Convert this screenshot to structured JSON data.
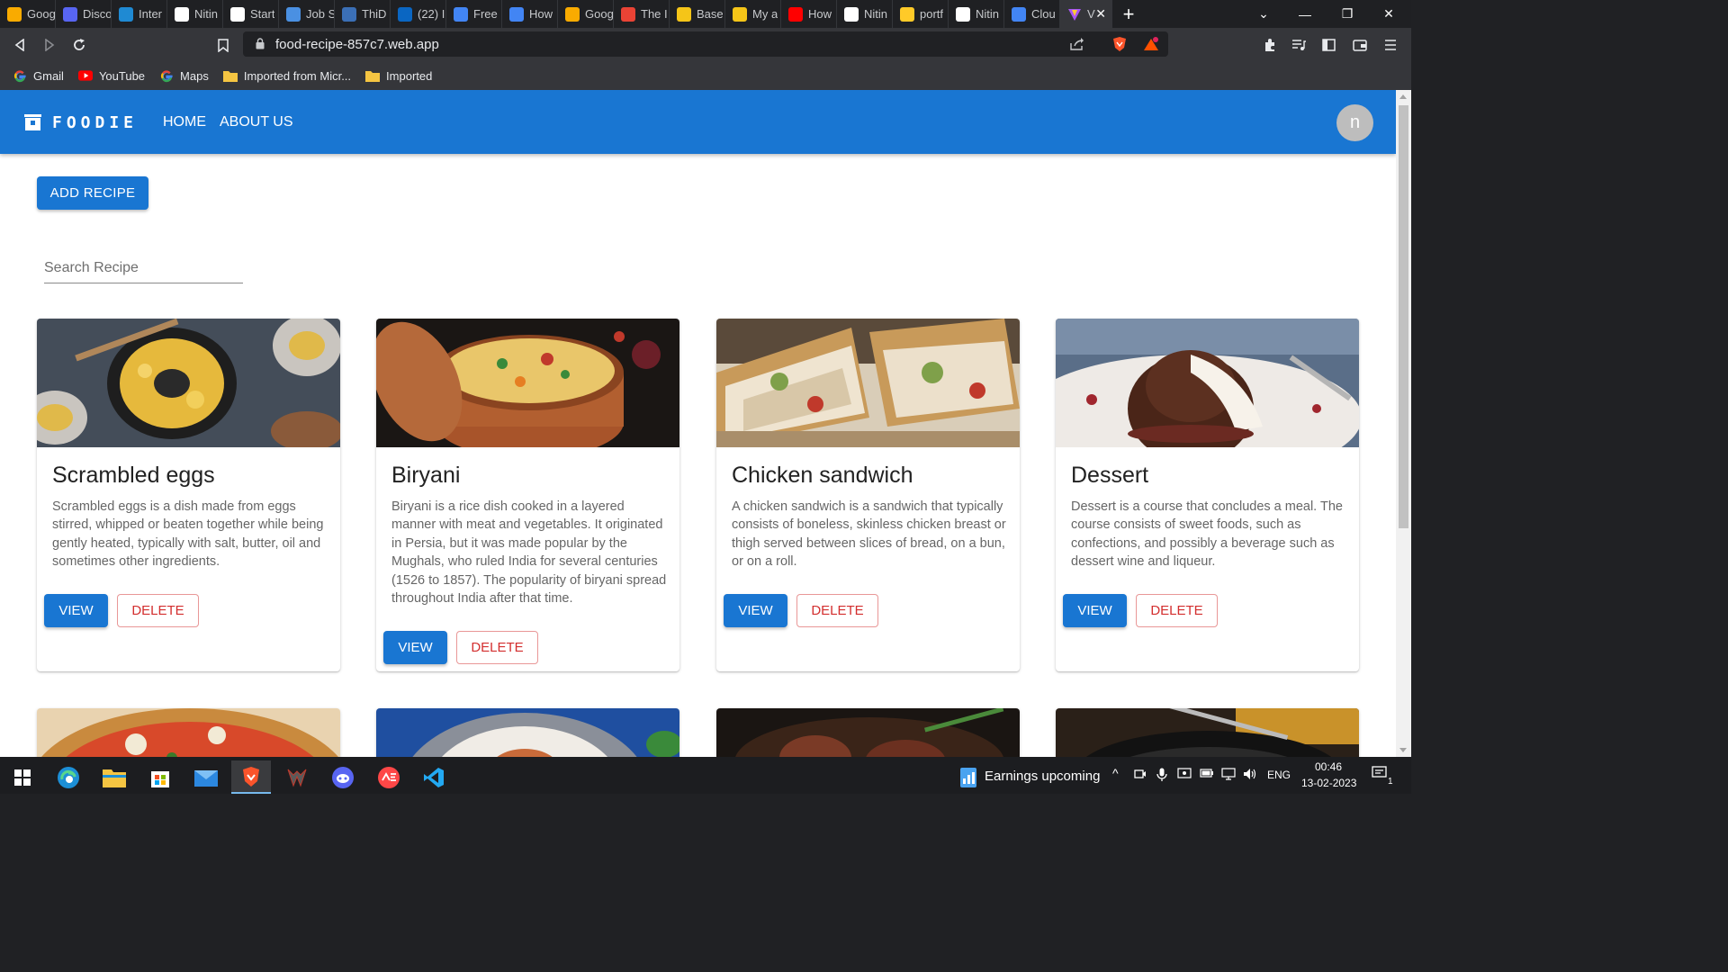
{
  "browser": {
    "tabs": [
      {
        "title": "Goog",
        "icon": "keep-icon",
        "color": "#f9ab00"
      },
      {
        "title": "Disco",
        "icon": "discord-icon",
        "color": "#5865f2"
      },
      {
        "title": "Inter",
        "icon": "interviewbit-icon",
        "color": "#1f8ad3"
      },
      {
        "title": "Nitin",
        "icon": "github-icon",
        "color": "#ffffff"
      },
      {
        "title": "Start",
        "icon": "w-icon",
        "color": "#ffffff"
      },
      {
        "title": "Job S",
        "icon": "info-icon",
        "color": "#4a90e2"
      },
      {
        "title": "ThiD",
        "icon": "t-icon",
        "color": "#3b6fb6"
      },
      {
        "title": "(22) I",
        "icon": "linkedin-icon",
        "color": "#0a66c2"
      },
      {
        "title": "Free",
        "icon": "circle-icon",
        "color": "#4285f4"
      },
      {
        "title": "How",
        "icon": "docs-icon",
        "color": "#4285f4"
      },
      {
        "title": "Goog",
        "icon": "keep-icon",
        "color": "#f9ab00"
      },
      {
        "title": "The I",
        "icon": "gmail-icon",
        "color": "#ea4335"
      },
      {
        "title": "Base",
        "icon": "emoji-icon",
        "color": "#f5c518"
      },
      {
        "title": "My a",
        "icon": "emoji-icon",
        "color": "#f5c518"
      },
      {
        "title": "How",
        "icon": "youtube-icon",
        "color": "#ff0000"
      },
      {
        "title": "Nitin",
        "icon": "triangle-icon",
        "color": "#ffffff"
      },
      {
        "title": "portf",
        "icon": "firebase-icon",
        "color": "#ffca28"
      },
      {
        "title": "Nitin",
        "icon": "github-icon",
        "color": "#ffffff"
      },
      {
        "title": "Clou",
        "icon": "cloud-icon",
        "color": "#4285f4"
      }
    ],
    "active_tab": {
      "title": "V",
      "icon": "vite-icon"
    },
    "url": "food-recipe-857c7.web.app",
    "bookmarks": [
      {
        "label": "Gmail",
        "icon": "google-icon"
      },
      {
        "label": "YouTube",
        "icon": "youtube-icon"
      },
      {
        "label": "Maps",
        "icon": "google-icon"
      },
      {
        "label": "Imported from Micr...",
        "icon": "folder-icon"
      },
      {
        "label": "Imported",
        "icon": "folder-icon"
      }
    ]
  },
  "app": {
    "brand": "FOODIE",
    "nav": [
      "HOME",
      "ABOUT US"
    ],
    "avatar_letter": "n",
    "add_button": "ADD RECIPE",
    "search_placeholder": "Search Recipe",
    "accent": "#1976d2",
    "danger": "#d32f2f",
    "recipes": [
      {
        "title": "Scrambled eggs",
        "description": "Scrambled eggs is a dish made from eggs stirred, whipped or beaten together while being gently heated, typically with salt, butter, oil and sometimes other ingredients.",
        "view": "VIEW",
        "delete": "DELETE"
      },
      {
        "title": "Biryani",
        "description": "Biryani is a rice dish cooked in a layered manner with meat and vegetables. It originated in Persia, but it was made popular by the Mughals, who ruled India for several centuries (1526 to 1857). The popularity of biryani spread throughout India after that time.",
        "view": "VIEW",
        "delete": "DELETE"
      },
      {
        "title": "Chicken sandwich",
        "description": "A chicken sandwich is a sandwich that typically consists of boneless, skinless chicken breast or thigh served between slices of bread, on a bun, or on a roll.",
        "view": "VIEW",
        "delete": "DELETE"
      },
      {
        "title": "Dessert",
        "description": "Dessert is a course that concludes a meal. The course consists of sweet foods, such as confections, and possibly a beverage such as dessert wine and liqueur.",
        "view": "VIEW",
        "delete": "DELETE"
      }
    ]
  },
  "taskbar": {
    "news": "Earnings upcoming",
    "language": "ENG",
    "time": "00:46",
    "date": "13-02-2023",
    "notifications": "1"
  }
}
